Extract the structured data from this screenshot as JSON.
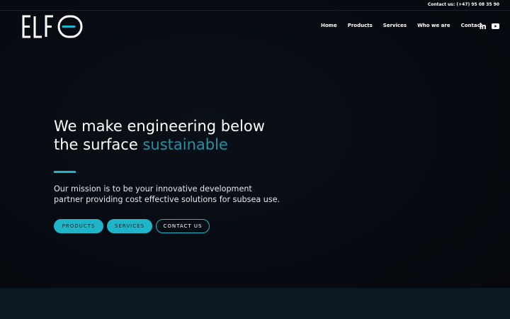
{
  "topbar": {
    "contact_text": "Contact us: (+47) 95 08 35 90"
  },
  "header": {
    "logo_alt": "ELFO",
    "nav": [
      {
        "label": "Home"
      },
      {
        "label": "Products"
      },
      {
        "label": "Services"
      },
      {
        "label": "Who we are"
      },
      {
        "label": "Contact"
      }
    ],
    "social": [
      {
        "icon": "linkedin-icon"
      },
      {
        "icon": "youtube-icon"
      }
    ]
  },
  "hero": {
    "headline_line1": "We make engineering below",
    "headline_line2_prefix": "the surface",
    "headline_accent": "sustainable",
    "mission": "Our mission is to be your innovative development partner providing cost effective solutions for subsea use.",
    "buttons": [
      {
        "label": "PRODUCTS"
      },
      {
        "label": "SERVICES"
      },
      {
        "label": "CONTACT US"
      }
    ]
  },
  "colors": {
    "background": "#070a10",
    "accent": "#1fb5c8",
    "accent_text": "#2a8ea1",
    "bottom_band": "#0b1721"
  }
}
